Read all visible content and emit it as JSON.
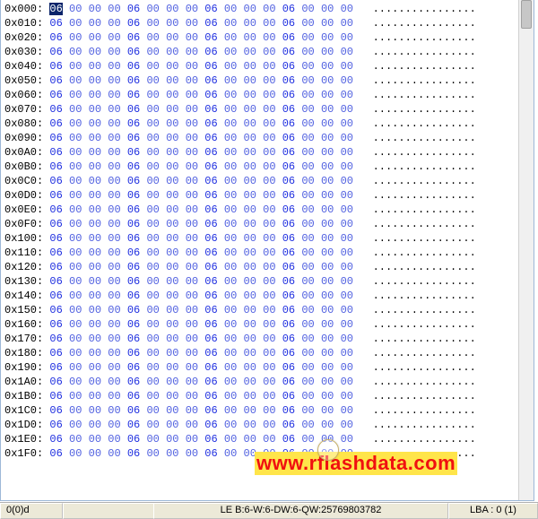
{
  "hex": {
    "row_count": 32,
    "start_offset_hex": "000",
    "offset_step": 16,
    "byte_pattern": [
      "06",
      "00",
      "00",
      "00"
    ],
    "bytes_per_row": 16,
    "ascii_pattern": ".",
    "cursor": {
      "row": 0,
      "col": 0
    }
  },
  "watermark": "www.rflashdata.com",
  "status": {
    "pos": "0(0)d",
    "le": "LE B:6-W:6-DW:6-QW:25769803782",
    "lba": "LBA : 0 (1)"
  }
}
